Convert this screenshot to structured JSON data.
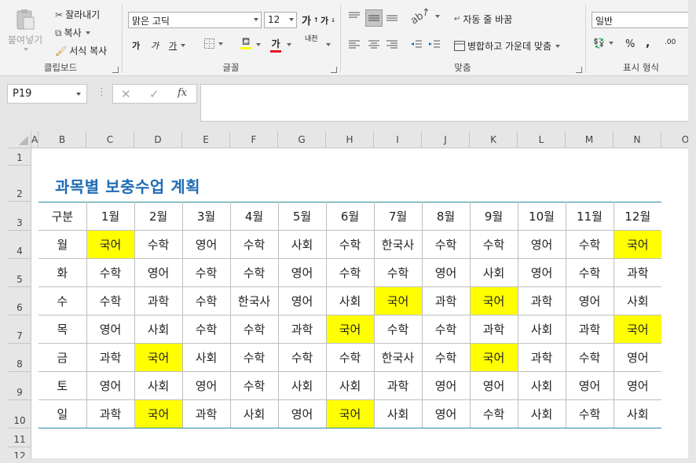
{
  "ribbon": {
    "clipboard": {
      "label": "클립보드",
      "paste": "붙여넣기",
      "cut": "잘라내기",
      "copy": "복사",
      "format_painter": "서식 복사"
    },
    "font": {
      "label": "글꼴",
      "font_name": "맑은 고딕",
      "font_size": "12",
      "grow_glyph": "가",
      "shrink_glyph": "가",
      "bold_glyph": "가",
      "italic_glyph": "가",
      "underline_glyph": "가",
      "color_glyph": "가",
      "phonetic_glyph": "내천"
    },
    "alignment": {
      "label": "맞춤",
      "wrap_text": "자동 줄 바꿈",
      "merge_center": "병합하고 가운데 맞춤"
    },
    "number": {
      "label": "표시 형식",
      "format": "일반",
      "percent": "%",
      "comma": ",",
      "inc_decimal": ".00"
    }
  },
  "formula_bar": {
    "name_box": "P19",
    "fx_glyph": "fx",
    "formula": ""
  },
  "grid": {
    "columns": [
      "A",
      "B",
      "C",
      "D",
      "E",
      "F",
      "G",
      "H",
      "I",
      "J",
      "K",
      "L",
      "M",
      "N",
      "O"
    ],
    "rows": [
      "1",
      "2",
      "3",
      "4",
      "5",
      "6",
      "7",
      "8",
      "9",
      "10",
      "11",
      "12"
    ]
  },
  "colors": {
    "title": "#1f6db5",
    "highlight": "#ffff00",
    "table_rule": "#2a8ca0"
  },
  "sheet": {
    "title": "과목별 보충수업 계획",
    "table": {
      "header": [
        "구분",
        "1월",
        "2월",
        "3월",
        "4월",
        "5월",
        "6월",
        "7월",
        "8월",
        "9월",
        "10월",
        "11월",
        "12월"
      ],
      "rows": [
        {
          "day": "월",
          "cells": [
            "국어",
            "수학",
            "영어",
            "수학",
            "사회",
            "수학",
            "한국사",
            "수학",
            "수학",
            "영어",
            "수학",
            "국어"
          ]
        },
        {
          "day": "화",
          "cells": [
            "수학",
            "영어",
            "수학",
            "수학",
            "영어",
            "수학",
            "수학",
            "영어",
            "사회",
            "영어",
            "수학",
            "과학"
          ]
        },
        {
          "day": "수",
          "cells": [
            "수학",
            "과학",
            "수학",
            "한국사",
            "영어",
            "사회",
            "국어",
            "과학",
            "국어",
            "과학",
            "영어",
            "사회"
          ]
        },
        {
          "day": "목",
          "cells": [
            "영어",
            "사회",
            "수학",
            "수학",
            "과학",
            "국어",
            "수학",
            "수학",
            "과학",
            "사회",
            "과학",
            "국어"
          ]
        },
        {
          "day": "금",
          "cells": [
            "과학",
            "국어",
            "사회",
            "수학",
            "수학",
            "수학",
            "한국사",
            "수학",
            "국어",
            "과학",
            "수학",
            "영어"
          ]
        },
        {
          "day": "토",
          "cells": [
            "영어",
            "사회",
            "영어",
            "수학",
            "사회",
            "사회",
            "과학",
            "영어",
            "영어",
            "사회",
            "영어",
            "영어"
          ]
        },
        {
          "day": "일",
          "cells": [
            "과학",
            "국어",
            "과학",
            "사회",
            "영어",
            "국어",
            "사회",
            "영어",
            "수학",
            "사회",
            "수학",
            "사회"
          ]
        }
      ],
      "highlighted_subject": "국어"
    }
  }
}
